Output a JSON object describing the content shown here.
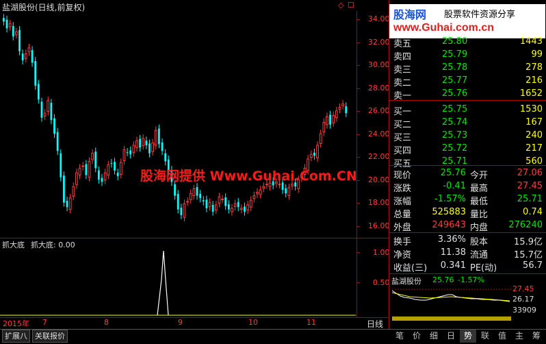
{
  "chart_header": {
    "title": "盐湖股份(日线,前复权)"
  },
  "watermark_top": {
    "brand": "股海网",
    "slogan": "股票软件资源分享",
    "url": "www.Guhai.com.cn"
  },
  "watermark_center": "股海网提供 Www.Guhai.Com.CN",
  "price_axis": [
    "34.00",
    "32.00",
    "30.00",
    "28.00",
    "26.00",
    "24.00",
    "22.00",
    "20.00",
    "18.00",
    "16.00"
  ],
  "indicator": {
    "name": "抓大底",
    "label": "抓大底: 0.00",
    "axis": [
      "1.00",
      "0.50"
    ]
  },
  "time_axis": {
    "year": "2015年",
    "months": [
      "7",
      "8",
      "9",
      "10",
      "11"
    ],
    "period": "日线"
  },
  "order_book": {
    "sells": [
      {
        "label": "卖五",
        "price": "25.80",
        "vol": "1443"
      },
      {
        "label": "卖四",
        "price": "25.79",
        "vol": "99"
      },
      {
        "label": "卖三",
        "price": "25.78",
        "vol": "278"
      },
      {
        "label": "卖二",
        "price": "25.77",
        "vol": "216"
      },
      {
        "label": "卖一",
        "price": "25.76",
        "vol": "1652"
      }
    ],
    "buys": [
      {
        "label": "买一",
        "price": "25.75",
        "vol": "1530"
      },
      {
        "label": "买二",
        "price": "25.74",
        "vol": "167"
      },
      {
        "label": "买三",
        "price": "25.73",
        "vol": "240"
      },
      {
        "label": "买四",
        "price": "25.72",
        "vol": "217"
      },
      {
        "label": "买五",
        "price": "25.71",
        "vol": "560"
      }
    ]
  },
  "stats": {
    "rows": [
      {
        "l1": "现价",
        "v1": "25.76",
        "l2": "今开",
        "v2": "27.06"
      },
      {
        "l1": "涨跌",
        "v1": "-0.41",
        "l2": "最高",
        "v2": "27.45"
      },
      {
        "l1": "涨幅",
        "v1": "-1.57%",
        "l2": "最低",
        "v2": "25.71"
      },
      {
        "l1": "总量",
        "v1": "525883",
        "l2": "量比",
        "v2": "0.74"
      },
      {
        "l1": "外盘",
        "v1": "249643",
        "l2": "内盘",
        "v2": "276240"
      }
    ]
  },
  "fundamentals": {
    "rows": [
      {
        "l1": "换手",
        "v1": "3.36%",
        "l2": "股本",
        "v2": "15.9亿"
      },
      {
        "l1": "净资",
        "v1": "11.38",
        "l2": "流通",
        "v2": "15.7亿"
      },
      {
        "l1": "收益(三)",
        "v1": "0.341",
        "l2": "PE(动)",
        "v2": "56.7"
      }
    ]
  },
  "mini_chart": {
    "name": "盐湖股份",
    "price": "25.76",
    "change": "-1.57%",
    "high": "27.45",
    "mid": "26.17",
    "vol": "33909"
  },
  "bottom_buttons": [
    "扩展八",
    "关联报价"
  ],
  "bottom_tabs": [
    "笔",
    "价",
    "细",
    "日",
    "势",
    "联",
    "值",
    "主",
    "筹"
  ],
  "colors": {
    "up": "#ff3b3b",
    "down": "#00ffff",
    "grid": "#b00000",
    "panel_bg": "#000000"
  }
}
